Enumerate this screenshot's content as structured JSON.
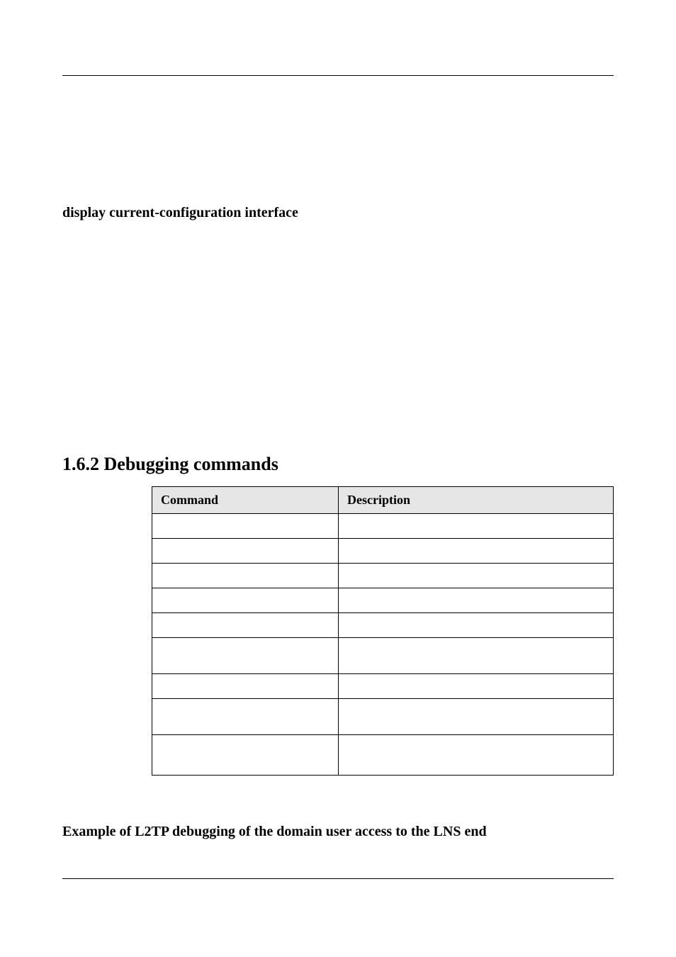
{
  "para_heading": "display current-configuration interface",
  "section_heading": "1.6.2 Debugging commands",
  "table": {
    "headers": {
      "command": "Command",
      "description": "Description"
    },
    "rows": [
      {
        "command": "",
        "description": "",
        "rowclass": "h-short"
      },
      {
        "command": "",
        "description": "",
        "rowclass": "h-short"
      },
      {
        "command": "",
        "description": "",
        "rowclass": "h-short"
      },
      {
        "command": "",
        "description": "",
        "rowclass": "h-short"
      },
      {
        "command": "",
        "description": "",
        "rowclass": "h-short"
      },
      {
        "command": "",
        "description": "",
        "rowclass": "h-tall"
      },
      {
        "command": "",
        "description": "",
        "rowclass": "h-short"
      },
      {
        "command": "",
        "description": "",
        "rowclass": "h-tall"
      },
      {
        "command": "",
        "description": "",
        "rowclass": "h-taller"
      }
    ]
  },
  "example_heading": "Example of L2TP debugging of the domain user access to the LNS end"
}
